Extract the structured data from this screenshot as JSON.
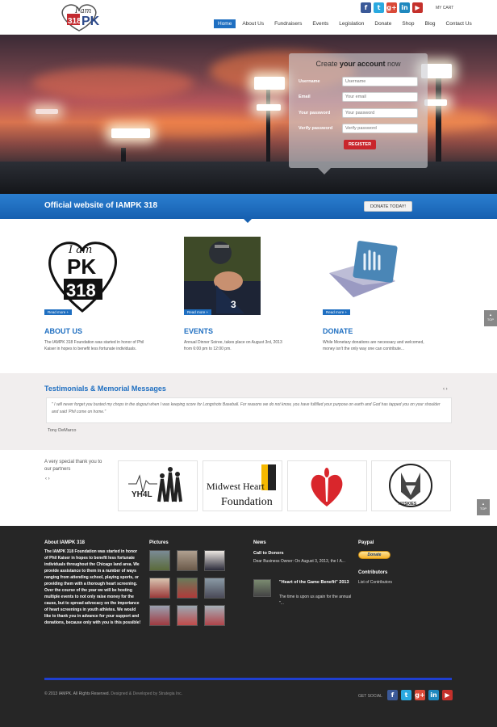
{
  "header": {
    "logo_text_top": "I am",
    "logo_text_num": "318",
    "logo_text_pk": "PK",
    "social": [
      "f",
      "t",
      "g+",
      "in",
      "▶"
    ],
    "my_cart": "MY CART",
    "nav": [
      "Home",
      "About Us",
      "Fundraisers",
      "Events",
      "Legislation",
      "Donate",
      "Shop",
      "Blog",
      "Contact Us"
    ]
  },
  "register": {
    "title_pre": "Create ",
    "title_bold": "your account",
    "title_post": " now",
    "username_label": "Username",
    "username_placeholder": "Username",
    "email_label": "Email",
    "email_placeholder": "Your email",
    "password_label": "Your password",
    "password_placeholder": "Your password",
    "verify_label": "Verify password",
    "verify_placeholder": "Verify password",
    "button": "REGISTER"
  },
  "band": {
    "title": "Official website of IAMPK 318",
    "button": "DONATE TODAY!"
  },
  "features": [
    {
      "heading": "ABOUT US",
      "text": "The IAMPK 318 Foundation was started in honor of Phil Kaiser in hopes to benefit less fortunate individuals.",
      "readmore": "Read more +"
    },
    {
      "heading": "EVENTS",
      "text": "Annual Dinner Soiree, takes place on August 3rd, 2013 from 6:00 pm to 12:00 pm.",
      "readmore": "Read more +"
    },
    {
      "heading": "DONATE",
      "text": "While Monetary donations are necessary and welcomed, money isn't the only way one can contribute...",
      "readmore": "Read more +"
    }
  ],
  "totop_label": "TOP",
  "testimonials": {
    "heading": "Testimonials & Memorial Messages",
    "quote": "\" I will never forget you busted my chops in the dugout when I was keeping score for Longshots Baseball. For reasons we do not know, you have fulfilled your purpose on earth and God has tapped you on your shoulder and said 'Phil come on home.\"",
    "author": "Tony DeMarco",
    "arrows": "‹ ›"
  },
  "partners": {
    "text": "A very special thank you to our partners",
    "arrows": "‹ ›",
    "logos": [
      "YH4L",
      "Midwest Heart Foundation",
      "American Heart Association",
      "Huskies"
    ],
    "mhf_line1": "Midwest Heart",
    "mhf_line2": "Foundation",
    "huskies_label": "HUSKIES",
    "yh4l_label": "YH4L"
  },
  "footer": {
    "about_heading": "About IAMPK 318",
    "about_text": "The IAMPK 318 Foundation was started in honor of Phil Kaiser in hopes to benefit less fortunate individuals throughout the Chicago land area. We provide assistance to them in a number of ways ranging from attending school, playing sports, or providing them with a thorough heart screening. Over the course of the year we will be hosting multiple events to not only raise money for the cause, but to spread advocacy on the importance of heart screenings in youth athletes. We would like to thank you in advance for your support and donations, because only with you is this possible!",
    "pictures_heading": "Pictures",
    "news_heading": "News",
    "news1_title": "Call to Donors",
    "news1_text": "Dear Business Owner: On August 3, 2013, the I A...",
    "news2_title": "\"Heart of the Game Benefit\" 2013",
    "news2_text": "The time is upon us again for the annual \"...",
    "paypal_heading": "Paypal",
    "paypal_button": "Donate",
    "contributors_heading": "Contributors",
    "contributors_link": "List of Contributors",
    "copyright": "© 2013 IAMPK. All Rights Reserved.",
    "designed": " Designed & Developed by Strategia Inc.",
    "get_social": "GET SOCIAL"
  },
  "colors": {
    "accent": "#1f6fc1",
    "footer_bg": "#262626",
    "register": "#c9262c"
  }
}
